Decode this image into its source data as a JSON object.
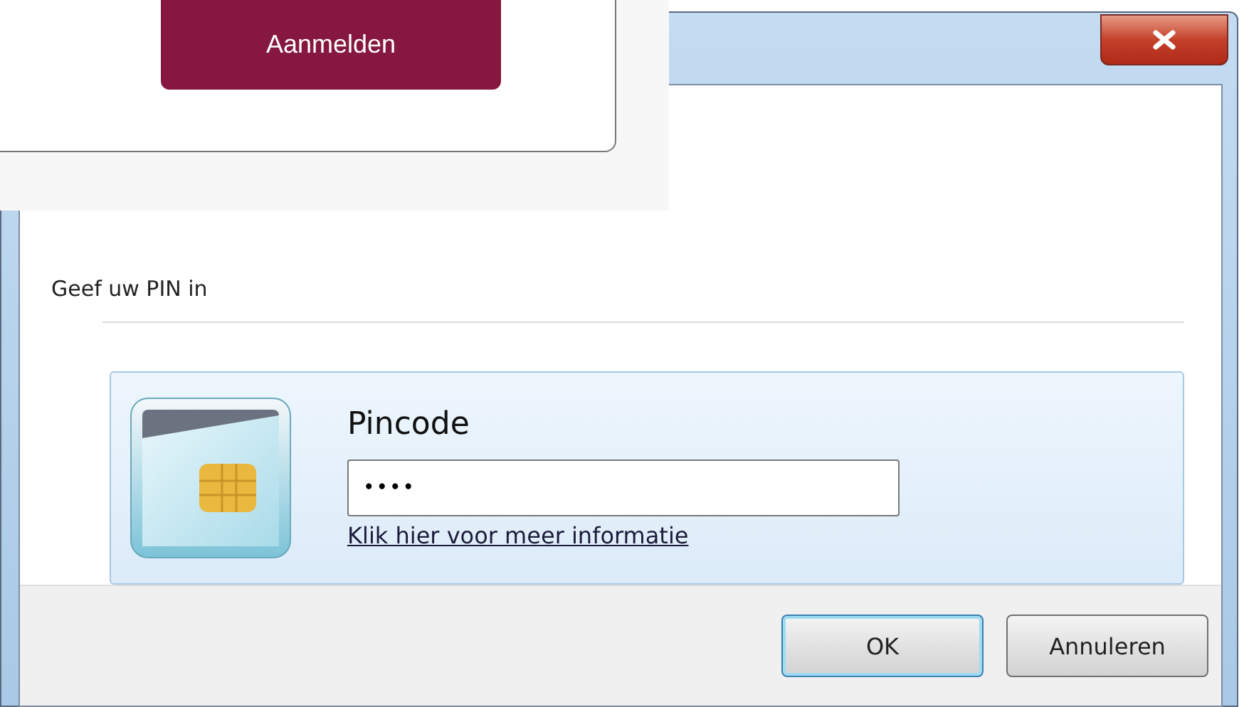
{
  "web_card": {
    "button": "Aanmelden"
  },
  "dialog": {
    "prompt": "Geef uw PIN in",
    "credential": {
      "label": "Pincode",
      "value": "••••",
      "link": "Klik hier voor meer informatie"
    },
    "buttons": [
      {
        "label": "OK",
        "kind": "default"
      },
      {
        "label": "Annuleren",
        "kind": "normal"
      }
    ]
  }
}
